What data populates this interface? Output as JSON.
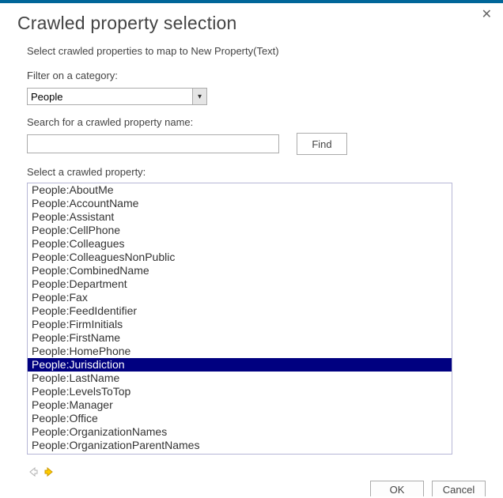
{
  "dialog": {
    "title": "Crawled property selection",
    "subtitle": "Select crawled properties to map to New Property(Text)"
  },
  "filter": {
    "label": "Filter on a category:",
    "selected": "People"
  },
  "search": {
    "label": "Search for a crawled property name:",
    "value": "",
    "find_label": "Find"
  },
  "list": {
    "label": "Select a crawled property:",
    "selected_index": 13,
    "items": [
      "People:AboutMe",
      "People:AccountName",
      "People:Assistant",
      "People:CellPhone",
      "People:Colleagues",
      "People:ColleaguesNonPublic",
      "People:CombinedName",
      "People:Department",
      "People:Fax",
      "People:FeedIdentifier",
      "People:FirmInitials",
      "People:FirstName",
      "People:HomePhone",
      "People:Jurisdiction",
      "People:LastName",
      "People:LevelsToTop",
      "People:Manager",
      "People:Office",
      "People:OrganizationNames",
      "People:OrganizationParentNames"
    ]
  },
  "buttons": {
    "ok": "OK",
    "cancel": "Cancel"
  }
}
